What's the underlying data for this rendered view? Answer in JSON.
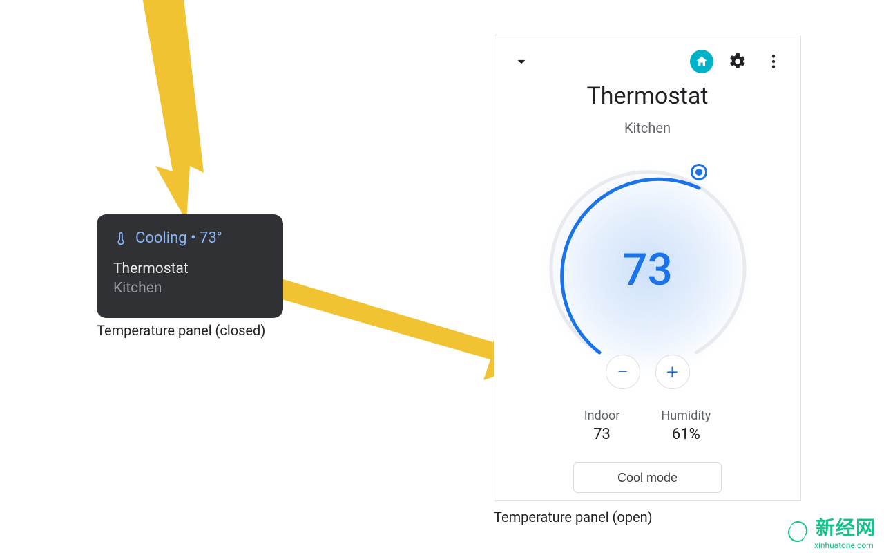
{
  "colors": {
    "accent_blue": "#1a73e8",
    "link_blue_dark": "#8ab4f8",
    "teal_home": "#00b2c7",
    "arrow_yellow": "#f1c232",
    "watermark_green": "#16c28b"
  },
  "closed": {
    "status_text": "Cooling • 73°",
    "device_name": "Thermostat",
    "room": "Kitchen",
    "caption": "Temperature panel (closed)"
  },
  "open": {
    "title": "Thermostat",
    "room": "Kitchen",
    "set_temp": "73",
    "indoor_label": "Indoor",
    "indoor_value": "73",
    "humidity_label": "Humidity",
    "humidity_value": "61%",
    "mode_button": "Cool mode",
    "caption": "Temperature panel (open)"
  },
  "icons": {
    "collapse": "chevron-down-icon",
    "home": "home-icon",
    "settings": "gear-icon",
    "overflow": "more-vert-icon",
    "thermo": "thermometer-icon",
    "minus": "−",
    "plus": "+"
  },
  "watermark": {
    "cn": "新经网",
    "en": "xinhuatone.com"
  }
}
